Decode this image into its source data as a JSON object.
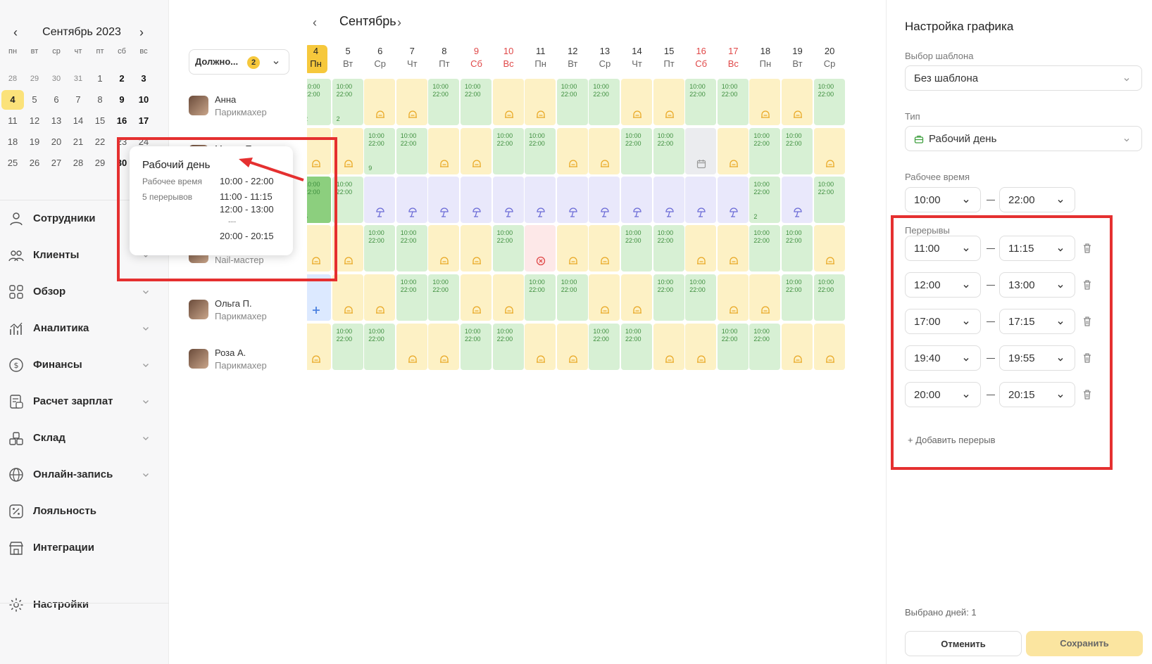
{
  "mini_calendar": {
    "title": "Сентябрь 2023",
    "weekdays": [
      "пн",
      "вт",
      "ср",
      "чт",
      "пт",
      "сб",
      "вс"
    ],
    "prev_days": [
      "28",
      "29",
      "30",
      "31"
    ],
    "weeks": [
      [
        "28",
        "29",
        "30",
        "31",
        "1",
        "2",
        "3"
      ],
      [
        "4",
        "5",
        "6",
        "7",
        "8",
        "9",
        "10"
      ],
      [
        "11",
        "12",
        "13",
        "14",
        "15",
        "16",
        "17"
      ],
      [
        "18",
        "19",
        "20",
        "21",
        "22",
        "23",
        "24"
      ],
      [
        "25",
        "26",
        "27",
        "28",
        "29",
        "30",
        ""
      ]
    ]
  },
  "nav": [
    {
      "label": "Сотрудники",
      "icon": "user-icon",
      "chevron": false
    },
    {
      "label": "Клиенты",
      "icon": "clients-icon",
      "chevron": true
    },
    {
      "label": "Обзор",
      "icon": "overview-icon",
      "chevron": true
    },
    {
      "label": "Аналитика",
      "icon": "analytics-icon",
      "chevron": true
    },
    {
      "label": "Финансы",
      "icon": "finance-icon",
      "chevron": true
    },
    {
      "label": "Расчет зарплат",
      "icon": "payroll-icon",
      "chevron": true
    },
    {
      "label": "Склад",
      "icon": "warehouse-icon",
      "chevron": true
    },
    {
      "label": "Онлайн-запись",
      "icon": "globe-icon",
      "chevron": true
    },
    {
      "label": "Лояльность",
      "icon": "percent-icon",
      "chevron": false
    },
    {
      "label": "Интеграции",
      "icon": "store-icon",
      "chevron": false
    },
    {
      "label": "Настройки",
      "icon": "gear-icon",
      "chevron": false
    }
  ],
  "filter": {
    "label": "Должно...",
    "count": "2"
  },
  "employees": [
    {
      "name": "Анна",
      "role": "Парикмахер"
    },
    {
      "name": "Мария П.",
      "role": ""
    },
    {
      "name": "",
      "role": ""
    },
    {
      "name": "",
      "role": "Nail-мастер"
    },
    {
      "name": "Ольга П.",
      "role": "Парикмахер"
    },
    {
      "name": "Роза А.",
      "role": "Парикмахер"
    }
  ],
  "schedule": {
    "month": "Сентябрь",
    "days": [
      {
        "n": "4",
        "w": "Пн",
        "weekend": false,
        "selected": true
      },
      {
        "n": "5",
        "w": "Вт",
        "weekend": false
      },
      {
        "n": "6",
        "w": "Ср",
        "weekend": false
      },
      {
        "n": "7",
        "w": "Чт",
        "weekend": false
      },
      {
        "n": "8",
        "w": "Пт",
        "weekend": false
      },
      {
        "n": "9",
        "w": "Сб",
        "weekend": true
      },
      {
        "n": "10",
        "w": "Вс",
        "weekend": true
      },
      {
        "n": "11",
        "w": "Пн",
        "weekend": false
      },
      {
        "n": "12",
        "w": "Вт",
        "weekend": false
      },
      {
        "n": "13",
        "w": "Ср",
        "weekend": false
      },
      {
        "n": "14",
        "w": "Чт",
        "weekend": false
      },
      {
        "n": "15",
        "w": "Пт",
        "weekend": false
      },
      {
        "n": "16",
        "w": "Сб",
        "weekend": true
      },
      {
        "n": "17",
        "w": "Вс",
        "weekend": true
      },
      {
        "n": "18",
        "w": "Пн",
        "weekend": false
      },
      {
        "n": "19",
        "w": "Вт",
        "weekend": false
      },
      {
        "n": "20",
        "w": "Ср",
        "weekend": false
      }
    ],
    "time_start": "10:00",
    "time_end": "22:00",
    "rows": [
      [
        "W2",
        "W2",
        "O",
        "O",
        "W",
        "W",
        "O",
        "O",
        "W",
        "W",
        "O",
        "O",
        "W",
        "W",
        "O",
        "O",
        "W"
      ],
      [
        "O",
        "O",
        "W9",
        "W",
        "O",
        "O",
        "W",
        "W",
        "O",
        "O",
        "W",
        "W",
        "P",
        "O",
        "W",
        "W",
        "O"
      ],
      [
        "S5",
        "W",
        "V",
        "V",
        "V",
        "V",
        "V",
        "V",
        "V",
        "V",
        "V",
        "V",
        "V",
        "V",
        "W2",
        "V",
        "W"
      ],
      [
        "O",
        "O",
        "W",
        "W",
        "O",
        "O",
        "W",
        "X",
        "O",
        "O",
        "W",
        "W",
        "O",
        "O",
        "W",
        "W",
        "O"
      ],
      [
        "F",
        "O",
        "O",
        "W",
        "W",
        "O",
        "O",
        "W",
        "W",
        "O",
        "O",
        "W",
        "W",
        "O",
        "O",
        "W",
        "W"
      ],
      [
        "O",
        "W",
        "W",
        "O",
        "O",
        "W",
        "W",
        "O",
        "O",
        "W",
        "W",
        "O",
        "O",
        "W",
        "W",
        "O",
        "O"
      ]
    ]
  },
  "tooltip": {
    "title": "Рабочий день",
    "work_label": "Рабочее время",
    "work_value": "10:00 - 22:00",
    "breaks_label": "5 перерывов",
    "breaks": [
      "11:00 - 11:15",
      "12:00 - 13:00",
      "....",
      "20:00 - 20:15"
    ]
  },
  "panel": {
    "title": "Настройка графика",
    "template_label": "Выбор шаблона",
    "template_value": "Без шаблона",
    "type_label": "Тип",
    "type_value": "Рабочий день",
    "work_time_label": "Рабочее время",
    "work_from": "10:00",
    "work_to": "22:00",
    "breaks_label": "Перерывы",
    "breaks": [
      {
        "from": "11:00",
        "to": "11:15"
      },
      {
        "from": "12:00",
        "to": "13:00"
      },
      {
        "from": "17:00",
        "to": "17:15"
      },
      {
        "from": "19:40",
        "to": "19:55"
      },
      {
        "from": "20:00",
        "to": "20:15"
      }
    ],
    "add_break": "+ Добавить перерыв",
    "selected_days": "Выбрано дней: 1",
    "cancel": "Отменить",
    "save": "Сохранить"
  },
  "colors": {
    "accent": "#f6c83c",
    "work": "#d7f0d4",
    "off": "#fdf1c5",
    "vacation": "#e9e8fb",
    "highlight": "#e53030"
  }
}
